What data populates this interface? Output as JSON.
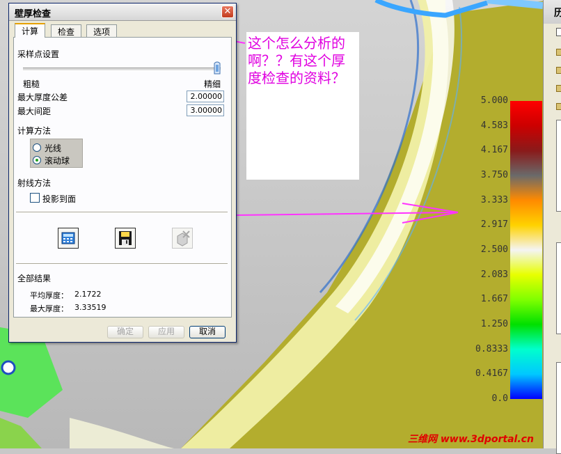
{
  "dialog": {
    "title": "壁厚检查",
    "close_glyph": "✕",
    "tabs": [
      {
        "label": "计算",
        "active": true
      },
      {
        "label": "检查",
        "active": false
      },
      {
        "label": "选项",
        "active": false
      }
    ],
    "sampling": {
      "title": "采样点设置",
      "left_label": "粗糙",
      "right_label": "精细",
      "slider_position": 1.0
    },
    "max_thickness_tol": {
      "label": "最大厚度公差",
      "value": "2.00000"
    },
    "max_spacing": {
      "label": "最大间距",
      "value": "3.00000"
    },
    "calc_method": {
      "title": "计算方法",
      "options": [
        {
          "label": "光线",
          "selected": false
        },
        {
          "label": "滚动球",
          "selected": true
        }
      ]
    },
    "ray_method": {
      "title": "射线方法",
      "project_label": "投影到面",
      "project_checked": false
    },
    "toolbar": {
      "calculate_icon": "calculator-icon",
      "save_icon": "floppy-disk-icon",
      "delete_icon": "delete-box-icon"
    },
    "results": {
      "title": "全部结果",
      "avg_label": "平均厚度：",
      "avg_value": "2.1722",
      "max_label": "最大厚度：",
      "max_value": "3.33519"
    },
    "buttons": {
      "ok": "确定",
      "apply": "应用",
      "cancel": "取消"
    }
  },
  "annotation": {
    "text": "这个怎么分析的啊？？有这个厚度检查的资料？",
    "color": "#e000e0"
  },
  "legend": {
    "ticks": [
      "5.000",
      "4.583",
      "4.167",
      "3.750",
      "3.333",
      "2.917",
      "2.500",
      "2.083",
      "1.667",
      "1.250",
      "0.8333",
      "0.4167",
      "0.0"
    ]
  },
  "side_panel": {
    "header_glyph": "历"
  },
  "watermark": "三维网 www.3dportal.cn",
  "colors": {
    "surface": "#b3ad2e",
    "annotation": "#e000e0",
    "watermark": "#e00000"
  }
}
